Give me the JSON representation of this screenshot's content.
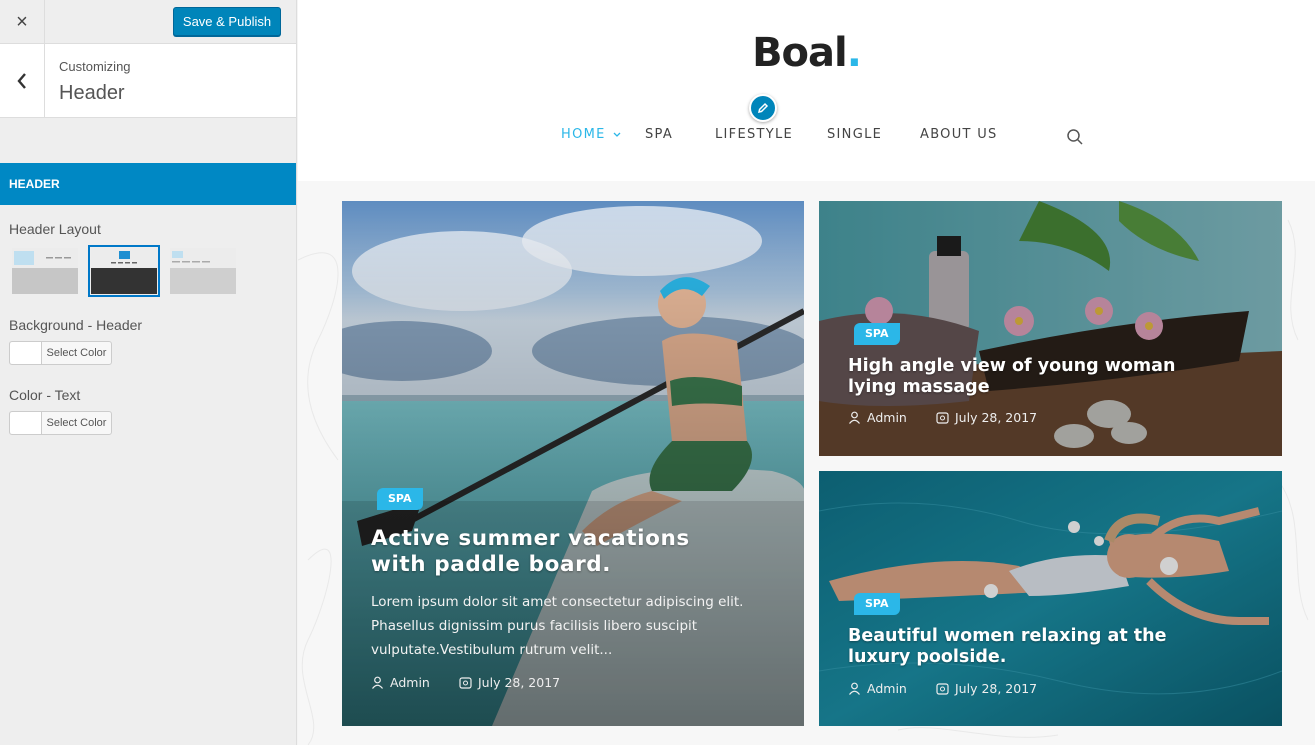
{
  "sidebar": {
    "close_icon": "×",
    "publish_label": "Save & Publish",
    "customizing_label": "Customizing",
    "section_title": "Header",
    "section_bar_label": "HEADER",
    "header_layout_label": "Header Layout",
    "background_label": "Background - Header",
    "background_button": "Select Color",
    "text_color_label": "Color - Text",
    "text_color_button": "Select Color",
    "selected_layout_index": 1
  },
  "site": {
    "logo_text": "Boal",
    "logo_dot": ".",
    "nav": [
      {
        "label": "HOME",
        "active": true,
        "has_dropdown": true
      },
      {
        "label": "SPA",
        "active": false
      },
      {
        "label": "LIFESTYLE",
        "active": false
      },
      {
        "label": "SINGLE",
        "active": false
      },
      {
        "label": "ABOUT US",
        "active": false
      }
    ]
  },
  "posts": [
    {
      "tag": "SPA",
      "title_lines": [
        "Active summer vacations",
        "with paddle board."
      ],
      "excerpt_lines": [
        "Lorem ipsum dolor sit amet consectetur adipiscing elit.",
        "Phasellus dignissim purus facilisis libero suscipit",
        "vulputate.Vestibulum rutrum velit..."
      ],
      "author": "Admin",
      "date": "July 28, 2017"
    },
    {
      "tag": "SPA",
      "title_lines": [
        "High angle view of young woman",
        "lying massage"
      ],
      "author": "Admin",
      "date": "July 28, 2017"
    },
    {
      "tag": "SPA",
      "title_lines": [
        "Beautiful women relaxing at the",
        "luxury poolside."
      ],
      "author": "Admin",
      "date": "July 28, 2017"
    }
  ],
  "colors": {
    "accent": "#2bb7e8",
    "wp_blue": "#0085ba",
    "section_bar": "#0088c4"
  }
}
